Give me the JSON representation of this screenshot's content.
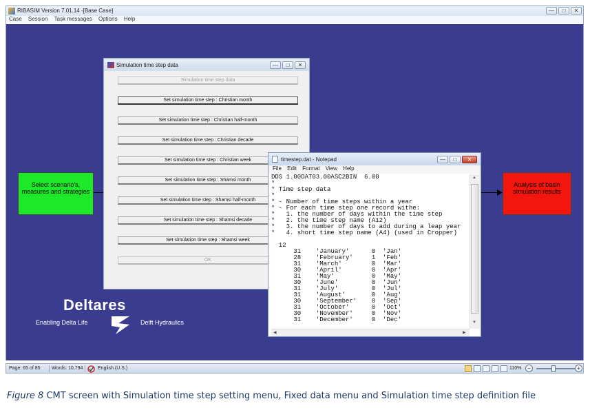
{
  "app": {
    "title": "RIBASIM Version 7.01.14 -[Base Case]",
    "menu": [
      "Case",
      "Session",
      "Task messages",
      "Options",
      "Help"
    ],
    "window_buttons": [
      "—",
      "□",
      "✕"
    ]
  },
  "workspace": {
    "background": "#3a3d8f",
    "green_box": "Select scenario's, measures and strategies",
    "red_box": "Analysis of basin simulation results",
    "logo": {
      "name": "Deltares",
      "tagline": "Enabling Delta Life",
      "subtitle": "Delft Hydraulics"
    }
  },
  "sim_dialog": {
    "title": "Simulation time step data",
    "buttons": [
      {
        "label": "Simulation time step data",
        "enabled": false
      },
      {
        "label": "Set simulation time step : Christian month",
        "enabled": true
      },
      {
        "label": "Set simulation time step : Christian half-month",
        "enabled": true
      },
      {
        "label": "Set simulation time step : Christian decade",
        "enabled": true
      },
      {
        "label": "Set simulation time step : Christian week",
        "enabled": true
      },
      {
        "label": "Set simulation time step : Shamsi month",
        "enabled": true
      },
      {
        "label": "Set simulation time step : Shamsi half-month",
        "enabled": true
      },
      {
        "label": "Set simulation time step : Shamsi decade",
        "enabled": true
      },
      {
        "label": "Set simulation time step : Shamsi week",
        "enabled": true
      },
      {
        "label": "OK",
        "enabled": false
      }
    ]
  },
  "notepad": {
    "title": "timestep.dat - Notepad",
    "menu": [
      "File",
      "Edit",
      "Format",
      "View",
      "Help"
    ],
    "content": "DDS 1.00DAT03.00ASC2BIN  6.00\n*\n* Time step data\n*\n* - Number of time steps within a year\n* - For each time step one record withe:\n*   1. the number of days within the time step\n*   2. the time step name (A12)\n*   3. the number of days to add during a leap year\n*   4. short time step name (A4) (used in Cropper)\n\n  12\n      31    'January'      0  'Jan'\n      28    'February'     1  'Feb'\n      31    'March'        0  'Mar'\n      30    'April'        0  'Apr'\n      31    'May'          0  'May'\n      30    'June'         0  'Jun'\n      31    'July'         0  'Jul'\n      31    'August'       0  'Aug'\n      30    'September'    0  'Sep'\n      31    'October'      0  'Oct'\n      30    'November'     0  'Nov'\n      31    'December'     0  'Dec'"
  },
  "statusbar": {
    "page": "Page: 65 of 85",
    "words": "Words: 10,794",
    "language": "English (U.S.)",
    "zoom": "110%",
    "zoom_out": "−",
    "zoom_in": "+"
  },
  "caption": {
    "label": "Figure 8",
    "text": " CMT screen with Simulation time step setting menu, Fixed data menu and Simulation time step definition file"
  }
}
